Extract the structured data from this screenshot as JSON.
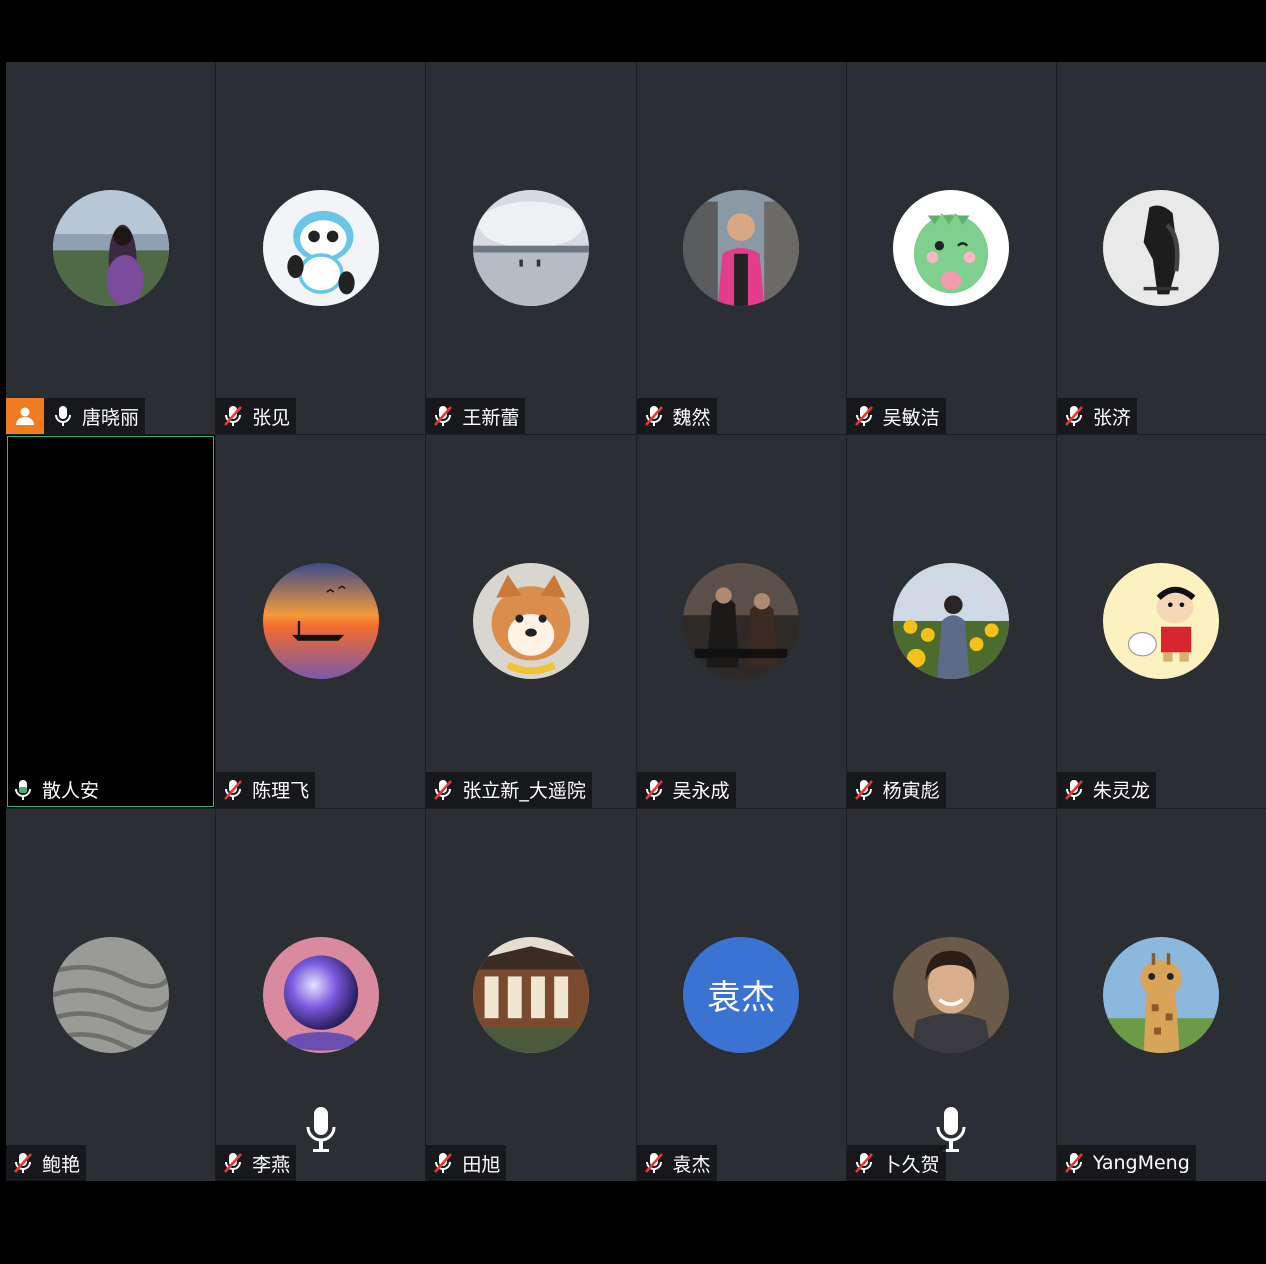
{
  "colors": {
    "tile_bg": "#2b2e33",
    "host_badge": "#f07b21",
    "active_border": "#3cb371",
    "text_avatar_bg": "#3b73d3"
  },
  "participants": [
    {
      "name": "唐晓丽",
      "mic": "on",
      "host": true,
      "avatar": "woman-lake-photo"
    },
    {
      "name": "张见",
      "mic": "muted",
      "avatar": "panda-mascot"
    },
    {
      "name": "王新蕾",
      "mic": "muted",
      "avatar": "cloudy-landscape"
    },
    {
      "name": "魏然",
      "mic": "muted",
      "avatar": "boy-photo"
    },
    {
      "name": "吴敏洁",
      "mic": "muted",
      "avatar": "green-dinosaur"
    },
    {
      "name": "张济",
      "mic": "muted",
      "avatar": "ink-painting"
    },
    {
      "name": "散人安",
      "mic": "speaking",
      "avatar": "none-black"
    },
    {
      "name": "陈理飞",
      "mic": "muted",
      "avatar": "sunset-boat"
    },
    {
      "name": "张立新_大遥院",
      "mic": "muted",
      "avatar": "shiba-dog"
    },
    {
      "name": "吴永成",
      "mic": "muted",
      "avatar": "biohazard-poster"
    },
    {
      "name": "杨寅彪",
      "mic": "muted",
      "avatar": "sunflower-field"
    },
    {
      "name": "朱灵龙",
      "mic": "muted",
      "avatar": "cartoon-boy"
    },
    {
      "name": "鲍艳",
      "mic": "muted",
      "avatar": "rock-texture"
    },
    {
      "name": "李燕",
      "mic": "muted",
      "avatar": "crystal-ball",
      "big_mic": true
    },
    {
      "name": "田旭",
      "mic": "muted",
      "avatar": "chinese-pavilion"
    },
    {
      "name": "袁杰",
      "mic": "muted",
      "avatar": "text",
      "avatar_text": "袁杰"
    },
    {
      "name": "卜久贺",
      "mic": "muted",
      "avatar": "man-portrait",
      "big_mic": true
    },
    {
      "name": "YangMeng",
      "mic": "muted",
      "avatar": "giraffe"
    }
  ]
}
